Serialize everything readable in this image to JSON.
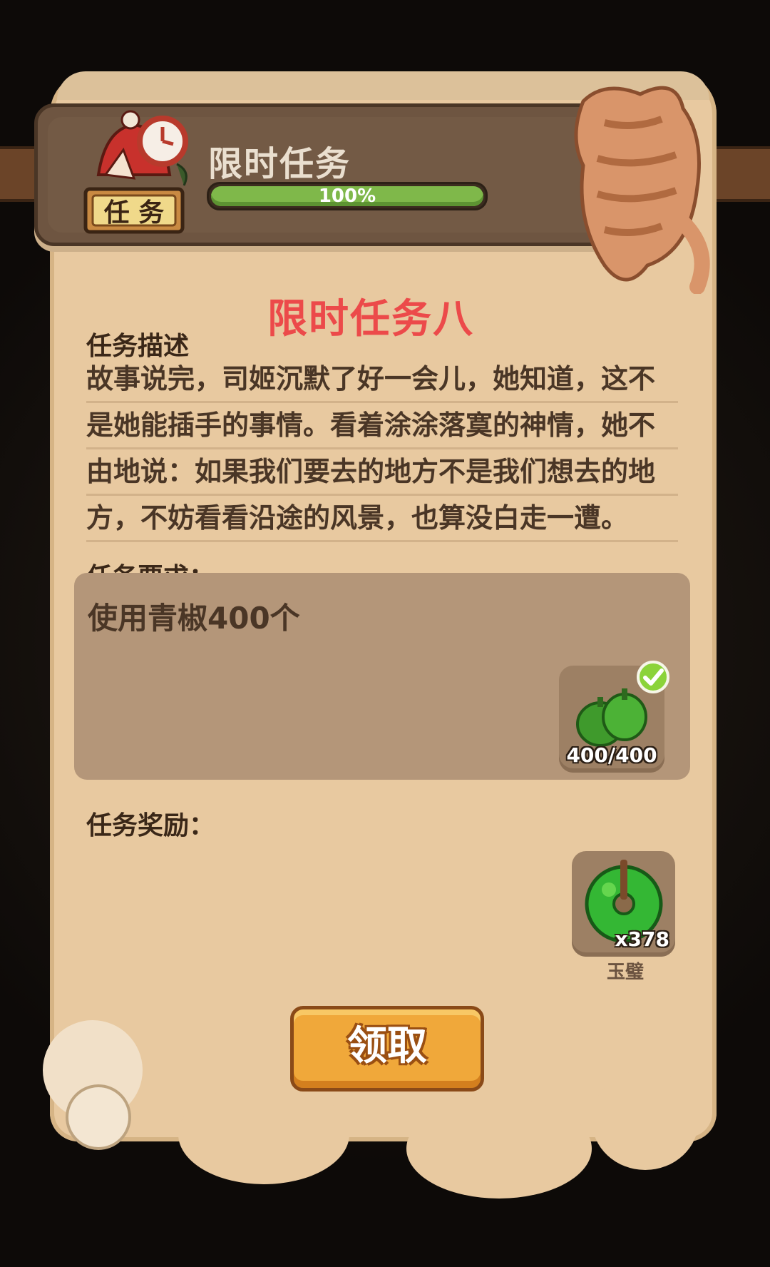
{
  "header": {
    "badge_text": "任 务",
    "title": "限时任务",
    "progress_label": "100%",
    "progress_value": 1.0
  },
  "quest": {
    "title": "限时任务八",
    "description_label": "任务描述",
    "description_lines": [
      "故事说完，司姬沉默了好一会儿，她知道，这不",
      "是她能插手的事情。看着涂涂落寞的神情，她不",
      "由地说：如果我们要去的地方不是我们想去的地",
      "方，不妨看看沿途的风景，也算没白走一遭。"
    ],
    "requirement_label": "任务要求：",
    "requirement_text": "使用青椒400个",
    "requirement_item": {
      "icon": "green-pepper-icon",
      "count": "400/400",
      "completed": true
    },
    "reward_label": "任务奖励：",
    "reward_item": {
      "icon": "jade-disc-icon",
      "count": "x378",
      "name": "玉璧"
    }
  },
  "actions": {
    "claim_label": "领取"
  },
  "colors": {
    "accent_title": "#ec4a4a",
    "paper": "#e8c9a0",
    "progress": "#7fb84a",
    "button": "#f0a83a"
  }
}
